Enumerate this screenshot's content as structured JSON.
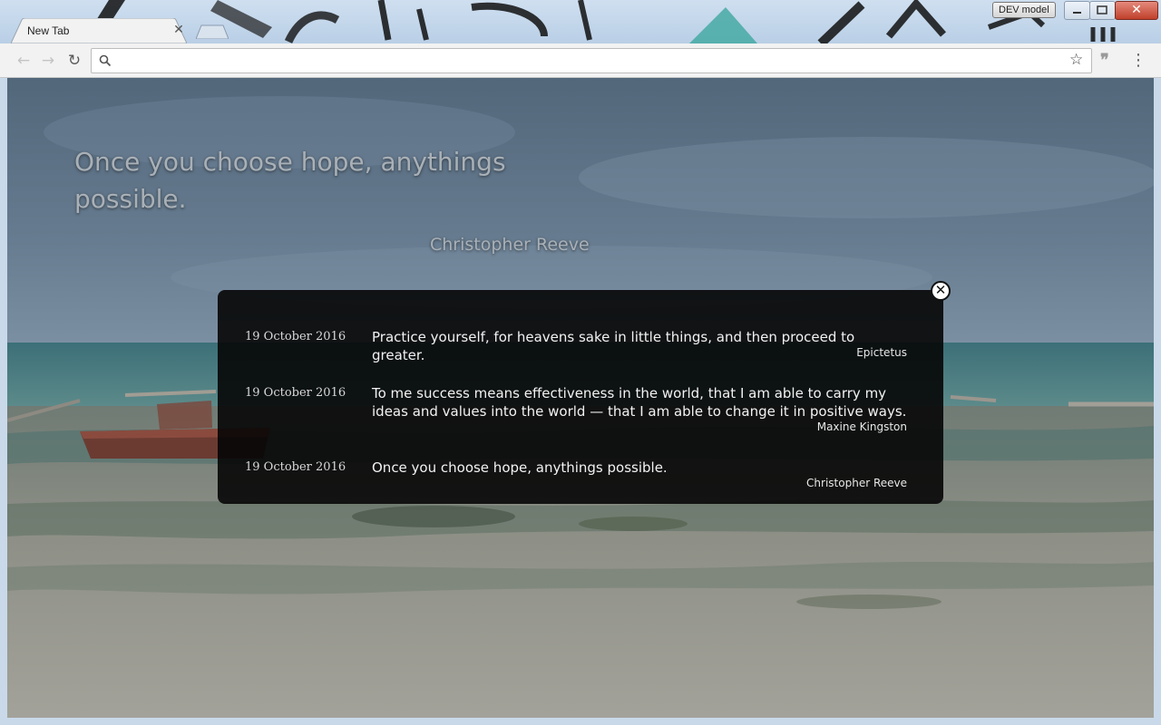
{
  "browser": {
    "tab_title": "New Tab",
    "dev_badge": "DEV model",
    "address_placeholder": "",
    "address_value": ""
  },
  "hero": {
    "quote": "Once you choose hope, anythings possible.",
    "author": "Christopher Reeve"
  },
  "history": {
    "entries": [
      {
        "date": "19 October 2016",
        "quote": "Practice yourself, for heavens sake in little things, and then proceed to greater.",
        "author": "Epictetus"
      },
      {
        "date": "19 October 2016",
        "quote": "To me success means effectiveness in the world, that I am able to carry my ideas and values into the world — that I am able to change it in positive ways.",
        "author": "Maxine Kingston"
      },
      {
        "date": "19 October 2016",
        "quote": "Once you choose hope, anythings possible.",
        "author": "Christopher Reeve"
      }
    ]
  },
  "icons": {
    "back": "back-arrow-icon",
    "forward": "forward-arrow-icon",
    "reload": "reload-icon",
    "search": "search-icon",
    "bookmark": "star-icon",
    "extension": "quote-icon",
    "menu": "kebab-menu-icon",
    "panel_close": "close-circle-icon"
  }
}
